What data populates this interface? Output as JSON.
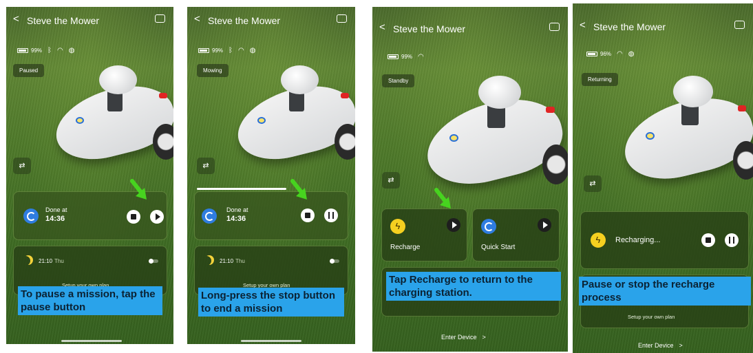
{
  "app": {
    "title": "Steve the Mower",
    "back_glyph": "<",
    "enter_device": "Enter Device",
    "enter_chevron": ">"
  },
  "colors": {
    "callout_bg": "#2aa3ea",
    "arrow_green": "#47d31f",
    "bolt_yellow": "#f5d020",
    "quick_blue": "#2f7de0"
  },
  "panels": [
    {
      "battery": "99%",
      "status_icons": [
        "bluetooth-icon",
        "wifi-icon",
        "signal-icon"
      ],
      "state": "Paused",
      "task": {
        "label": "Done at",
        "time": "14:36",
        "buttons": [
          "stop-icon",
          "play-icon"
        ]
      },
      "schedule": {
        "time": "21:10",
        "day": "Thu",
        "link": "Setup your own plan"
      },
      "callout": "To pause a mission, tap the pause button"
    },
    {
      "battery": "99%",
      "status_icons": [
        "bluetooth-icon",
        "wifi-icon",
        "signal-icon"
      ],
      "state": "Mowing",
      "task": {
        "label": "Done at",
        "time": "14:36",
        "buttons": [
          "stop-icon",
          "pause-icon"
        ]
      },
      "schedule": {
        "time": "21:10",
        "day": "Thu",
        "link": "Setup your own plan"
      },
      "callout": "Long-press the stop button to end a mission"
    },
    {
      "battery": "99%",
      "status_icons": [
        "wifi-icon"
      ],
      "state": "Standby",
      "tiles": [
        {
          "label": "Recharge",
          "icon": "bolt-icon",
          "button": "play-icon"
        },
        {
          "label": "Quick Start",
          "icon": "quick-start-icon",
          "button": "play-icon"
        }
      ],
      "callout": "Tap Recharge to return to the charging station."
    },
    {
      "battery": "96%",
      "status_icons": [
        "wifi-icon",
        "signal-icon"
      ],
      "state": "Returning",
      "task": {
        "label": "Recharging...",
        "buttons": [
          "stop-icon",
          "pause-icon"
        ]
      },
      "schedule": {
        "link": "Setup your own plan"
      },
      "callout": "Pause or stop the recharge process"
    }
  ]
}
